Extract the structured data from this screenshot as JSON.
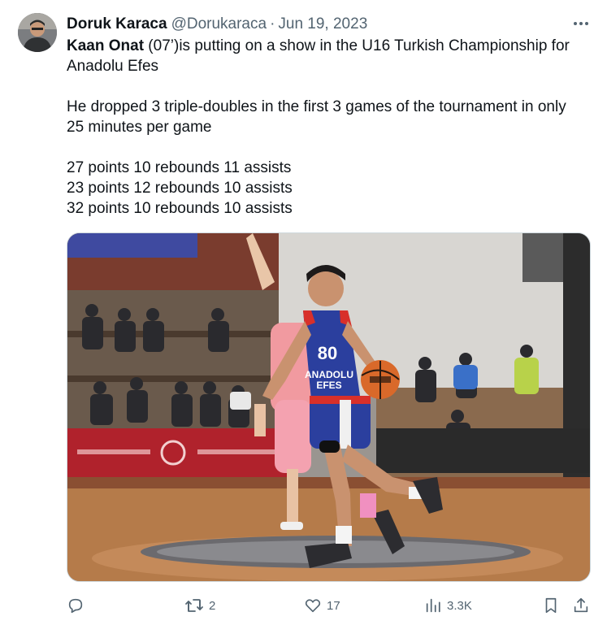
{
  "author": {
    "display_name": "Doruk Karaca",
    "handle": "@Dorukaraca",
    "separator": "·",
    "date": "Jun 19, 2023"
  },
  "tweet": {
    "mention": "Kaan Onat",
    "line1_rest": " (07’)is putting on a show in the U16 Turkish Championship for",
    "line2": "Anadolu Efes",
    "para2_line1": "He dropped 3 triple-doubles in the first 3 games of the tournament in only",
    "para2_line2": "25 minutes per game",
    "stats": [
      "27 points 10 rebounds 11 assists",
      "23 points 12 rebounds 10 assists",
      "32 points 10 rebounds 10 assists"
    ]
  },
  "media": {
    "jersey_number": "80",
    "jersey_text_line1": "ANADOLU",
    "jersey_text_line2": "EFES"
  },
  "actions": {
    "replies": "",
    "retweets": "2",
    "likes": "17",
    "views": "3.3K"
  },
  "colors": {
    "text": "#0f1419",
    "secondary": "#536471",
    "jersey_blue": "#2b3f9e",
    "court": "#b57b4a"
  }
}
